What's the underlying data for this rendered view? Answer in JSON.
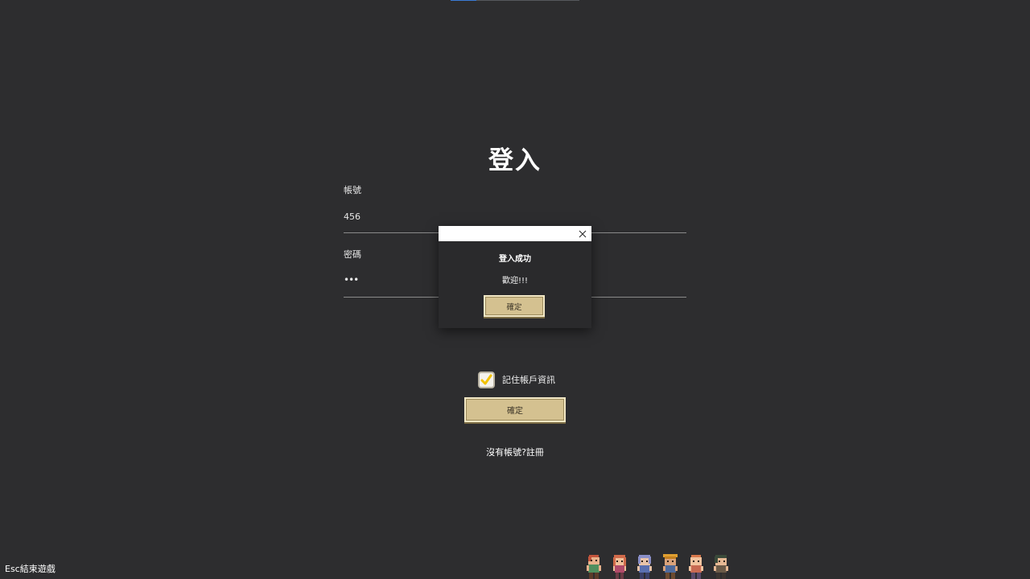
{
  "login": {
    "title": "登入",
    "account_label": "帳號",
    "account_value": "456",
    "password_label": "密碼",
    "password_value": "•••",
    "remember_label": "記住帳戶資訊",
    "remember_checked": true,
    "confirm_label": "確定",
    "register_link": "沒有帳號?註冊"
  },
  "footer": {
    "esc_hint": "Esc結束遊戲"
  },
  "dialog": {
    "title": "登入成功",
    "message": "歡迎!!!",
    "confirm_label": "確定",
    "close_icon": "close-icon"
  },
  "characters": [
    "pixel-character",
    "pixel-character",
    "pixel-character",
    "pixel-character",
    "pixel-character",
    "pixel-character"
  ],
  "colors": {
    "background": "#2d2d2f",
    "button_fill": "#d4c190",
    "button_border": "#f3e8c5",
    "check_mark": "#f2c200",
    "dialog_bg": "#2a2a2c",
    "dialog_header": "#ffffff"
  }
}
